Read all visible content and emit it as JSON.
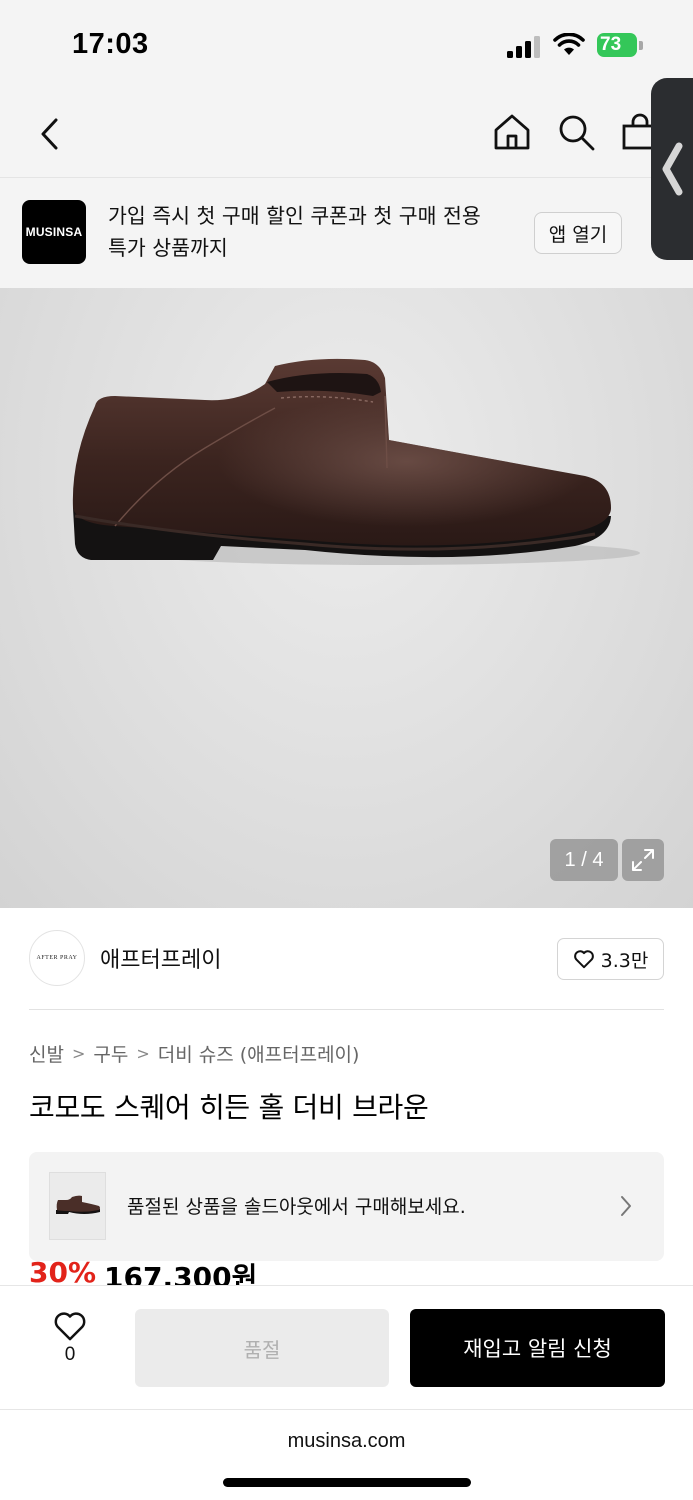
{
  "status_bar": {
    "time": "17:03",
    "battery_level": "73",
    "signal_icon": "cellular-signal-icon",
    "wifi_icon": "wifi-icon"
  },
  "nav": {
    "back_icon": "chevron-left-icon",
    "home_icon": "home-icon",
    "search_icon": "search-icon",
    "bag_icon": "shopping-bag-icon"
  },
  "banner": {
    "logo_text": "MUSINSA",
    "message_line1": "가입 즉시 첫 구매 할인 쿠폰과 첫 구매 전용",
    "message_line2": "특가 상품까지",
    "open_app_label": "앱 열기"
  },
  "gallery": {
    "counter": "1 / 4",
    "expand_icon": "expand-icon"
  },
  "brand": {
    "avatar_text": "AFTER PRAY",
    "name": "애프터프레이",
    "likes": "3.3만"
  },
  "breadcrumb": [
    "신발",
    "구두",
    "더비 슈즈 (애프터프레이)"
  ],
  "product": {
    "title": "코모도 스퀘어 히든 홀 더비 브라운",
    "discount": "30%",
    "price": "167,300원"
  },
  "soldout_card": {
    "text": "품절된 상품을 솔드아웃에서 구매해보세요."
  },
  "bottom_bar": {
    "wish_count": "0",
    "soldout_label": "품절",
    "restock_label": "재입고 알림 신청"
  },
  "browser": {
    "url": "musinsa.com"
  },
  "colors": {
    "accent_discount": "#e2231a",
    "primary_button": "#000000",
    "battery": "#34c759"
  }
}
